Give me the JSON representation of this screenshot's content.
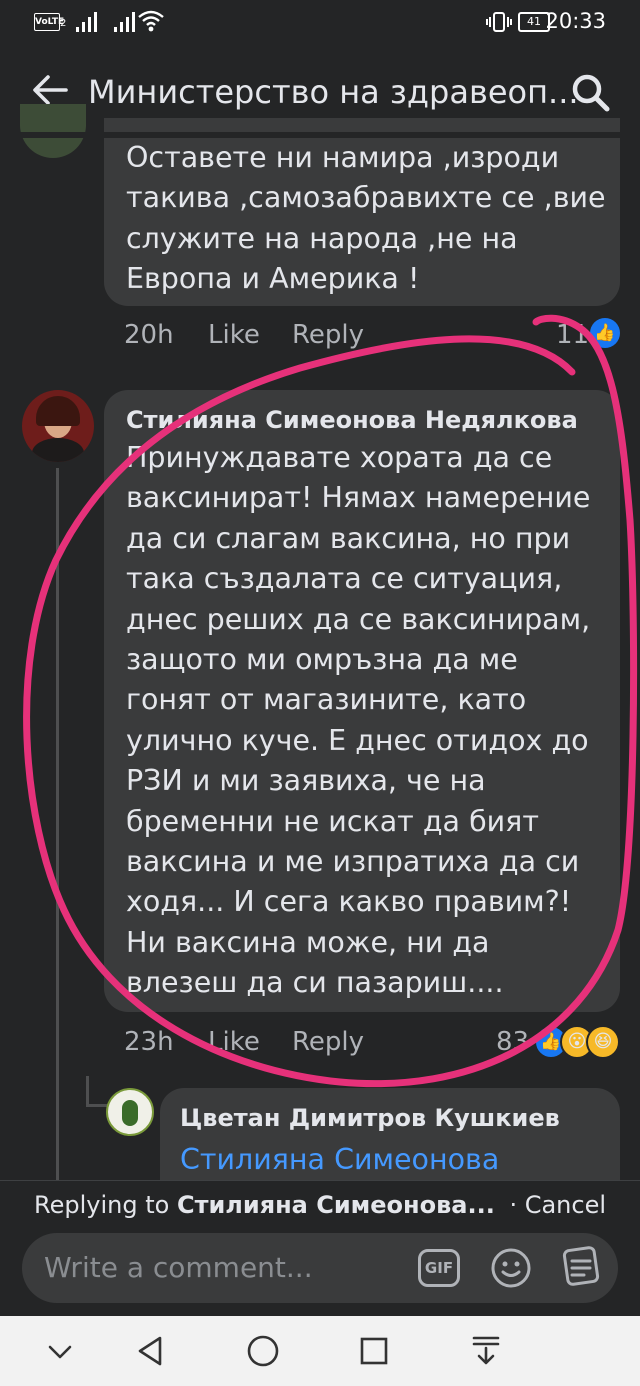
{
  "status_bar": {
    "volte": "VoLTE",
    "sim_index": "2",
    "battery": "41",
    "time": "20:33"
  },
  "header": {
    "title": "Министерство на здравеоп...",
    "back_icon": "arrow-left-icon",
    "search_icon": "search-icon"
  },
  "comments": [
    {
      "text_lines": [
        "Оставете ни намира ,изроди",
        "такива ,самозабравихте се ,вие",
        "служите на народа ,не на",
        "Европа и Америка !"
      ],
      "time": "20h",
      "like": "Like",
      "reply": "Reply",
      "reactions_count": "11"
    },
    {
      "author": "Стилияна Симеонова Недялкова",
      "text_lines": [
        "Принуждавате хората да се",
        "ваксинират! Нямах намерение",
        "да си слагам ваксина, но при",
        "така създалата се ситуация,",
        "днес реших да се ваксинирам,",
        "защото ми омръзна да ме",
        "гонят от магазините, като",
        "улично куче. Е днес отидох до",
        "РЗИ и ми заявиха, че на",
        "бременни не искат да бият",
        "ваксина и ме изпратиха да си",
        "ходя... И сега какво правим?!",
        "Ни ваксина може, ни да",
        "влезеш да си пазариш...."
      ],
      "time": "23h",
      "like": "Like",
      "reply": "Reply",
      "reactions_count": "83"
    },
    {
      "author": "Цветан Димитров Кушкиев",
      "mention": "Стилияна Симеонова"
    }
  ],
  "reply_bar": {
    "prefix": "Replying to",
    "name": "Стилияна Симеонова...",
    "cancel": "· Cancel"
  },
  "composer": {
    "placeholder": "Write a comment...",
    "gif": "GIF"
  },
  "colors": {
    "background": "#242526",
    "bubble": "#3a3b3c",
    "mention": "#4599ff",
    "annotation": "#e6317a"
  }
}
